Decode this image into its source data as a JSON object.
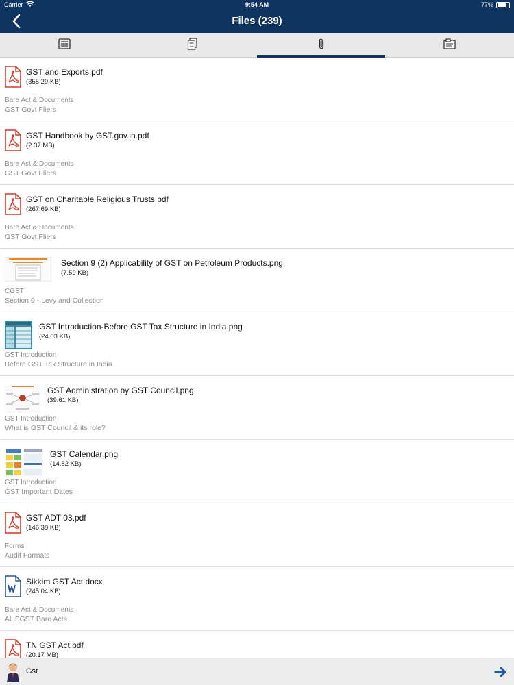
{
  "status_bar": {
    "carrier": "Carrier",
    "time": "9:54 AM",
    "battery": "77%",
    "battery_level": 0.77
  },
  "nav": {
    "title": "Files (239)"
  },
  "tabs": [
    {
      "icon": "list-icon",
      "active": false
    },
    {
      "icon": "documents-icon",
      "active": false
    },
    {
      "icon": "paperclip-icon",
      "active": true
    },
    {
      "icon": "clipboard-icon",
      "active": false
    }
  ],
  "files": [
    {
      "name": "GST and Exports.pdf",
      "size": "(355.29 KB)",
      "category": "Bare Act & Documents",
      "subcategory": "GST Govt Fliers",
      "thumb": "pdf"
    },
    {
      "name": "GST Handbook by GST.gov.in.pdf",
      "size": "(2.37 MB)",
      "category": "Bare Act & Documents",
      "subcategory": "GST Govt Fliers",
      "thumb": "pdf"
    },
    {
      "name": "GST on Charitable Religious Trusts.pdf",
      "size": "(267.69 KB)",
      "category": "Bare Act & Documents",
      "subcategory": "GST Govt Fliers",
      "thumb": "pdf"
    },
    {
      "name": "Section 9 (2) Applicability of GST on Petroleum Products.png",
      "size": "(7.59 KB)",
      "category": "CGST",
      "subcategory": "Section 9 - Levy and Collection",
      "thumb": "image-doc"
    },
    {
      "name": "GST Introduction-Before GST Tax Structure in India.png",
      "size": "(24.03 KB)",
      "category": "GST Introduction",
      "subcategory": "Before GST Tax Structure in India",
      "thumb": "image-table"
    },
    {
      "name": "GST Administration by GST Council.png",
      "size": "(39.61 KB)",
      "category": "GST Introduction",
      "subcategory": "What is GST Council & its role?",
      "thumb": "image-diagram"
    },
    {
      "name": "GST Calendar.png",
      "size": "(14.82 KB)",
      "category": "GST Introduction",
      "subcategory": "GST Important Dates",
      "thumb": "image-calendar"
    },
    {
      "name": "GST ADT 03.pdf",
      "size": "(146.38 KB)",
      "category": "Forms",
      "subcategory": "Audit Formats",
      "thumb": "pdf"
    },
    {
      "name": "Sikkim GST Act.docx",
      "size": "(245.04 KB)",
      "category": "Bare Act & Documents",
      "subcategory": "All SGST Bare Acts",
      "thumb": "word"
    },
    {
      "name": "TN GST Act.pdf",
      "size": "(20.17 MB)",
      "category": "",
      "subcategory": "",
      "thumb": "pdf"
    }
  ],
  "bottom_bar": {
    "query": "Gst"
  },
  "colors": {
    "primary": "#0f3460",
    "pdf_red": "#d23b2a",
    "word_blue": "#2b579a",
    "accent_arrow": "#1f5ea8"
  }
}
